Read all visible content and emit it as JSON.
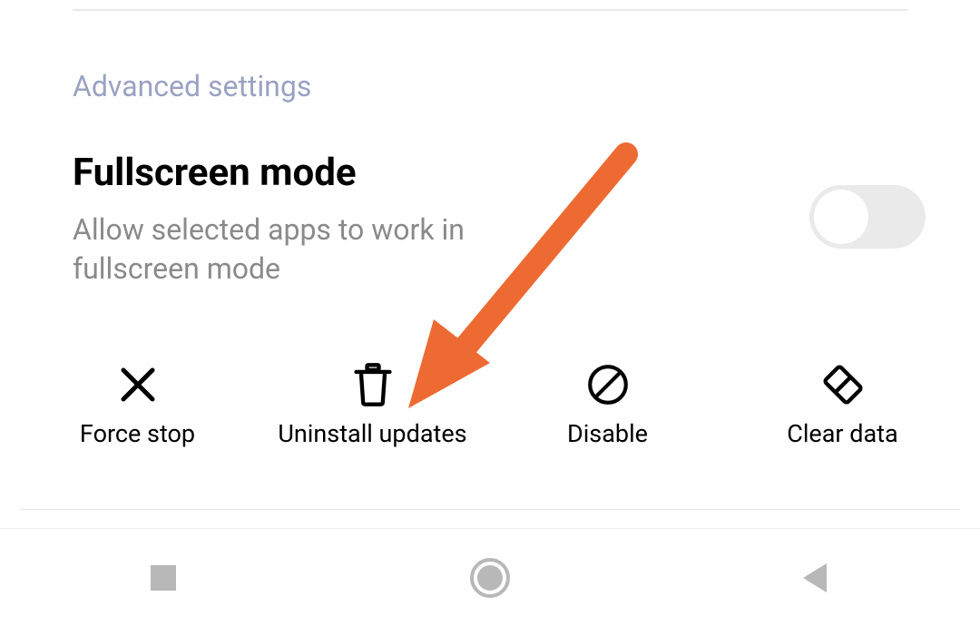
{
  "section_header": "Advanced settings",
  "setting": {
    "title": "Fullscreen mode",
    "description": "Allow selected apps to work in fullscreen mode",
    "toggle_on": false
  },
  "actions": {
    "force_stop": "Force stop",
    "uninstall_updates": "Uninstall updates",
    "disable": "Disable",
    "clear_data": "Clear data"
  },
  "nav": {
    "recent": "recent-apps",
    "home": "home",
    "back": "back"
  }
}
